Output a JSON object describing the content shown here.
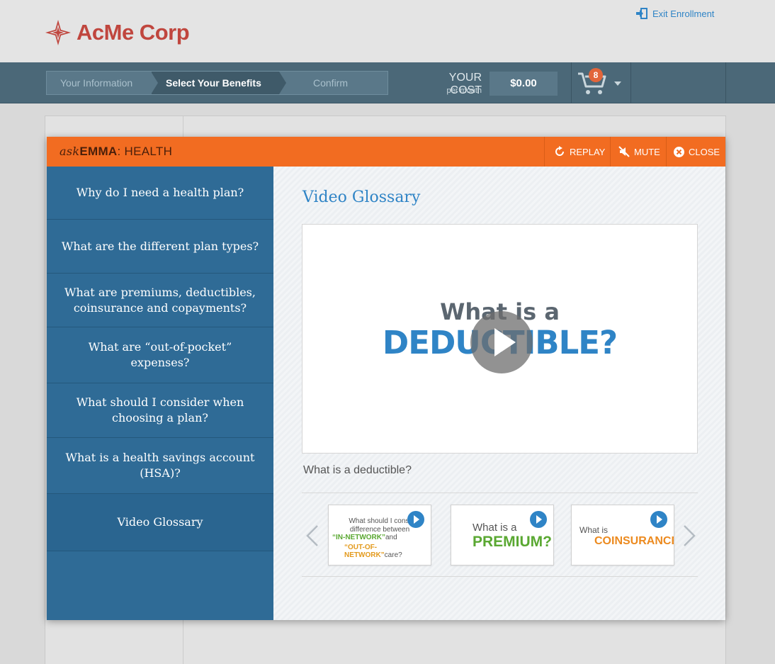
{
  "brand": {
    "name": "AcMe Corp",
    "color": "#c0463e"
  },
  "header": {
    "exit_label": "Exit Enrollment"
  },
  "steps": [
    {
      "label": "Your Information",
      "state": "done"
    },
    {
      "label": "Select Your Benefits",
      "state": "active"
    },
    {
      "label": "Confirm",
      "state": "upcoming"
    }
  ],
  "cost": {
    "label": "YOUR COST",
    "sublabel": "per month",
    "value": "$0.00"
  },
  "cart": {
    "count": "8"
  },
  "modal": {
    "title_prefix": "ask",
    "title_name": "EMMA",
    "title_suffix": ": HEALTH",
    "replay_label": "REPLAY",
    "mute_label": "MUTE",
    "close_label": "CLOSE",
    "accent_color": "#f26c21"
  },
  "sidebar": {
    "items": [
      {
        "label": "Why do I need a health plan?"
      },
      {
        "label": "What are the different plan types?"
      },
      {
        "label": "What are premiums, deductibles, coinsurance and copayments?"
      },
      {
        "label": "What are “out-of-pocket” expenses?"
      },
      {
        "label": "What should I consider when choosing a plan?"
      },
      {
        "label": "What is a health savings account (HSA)?"
      },
      {
        "label": "Video Glossary"
      }
    ],
    "active_index": 6
  },
  "content": {
    "title": "Video Glossary",
    "video": {
      "line1": "What is a",
      "line2": "DEDUCTIBLE?",
      "caption": "What is a deductible?"
    },
    "thumbnails": [
      {
        "line1": "What should I consi",
        "line1b": "difference between",
        "green": "“IN-NETWORK”",
        "and": "and",
        "orange": "“OUT-OF-NETWORK”",
        "tail": "care?"
      },
      {
        "line1": "What is a",
        "highlight": "PREMIUM?"
      },
      {
        "line1": "What is",
        "highlight": "COINSURANCE?"
      }
    ]
  }
}
